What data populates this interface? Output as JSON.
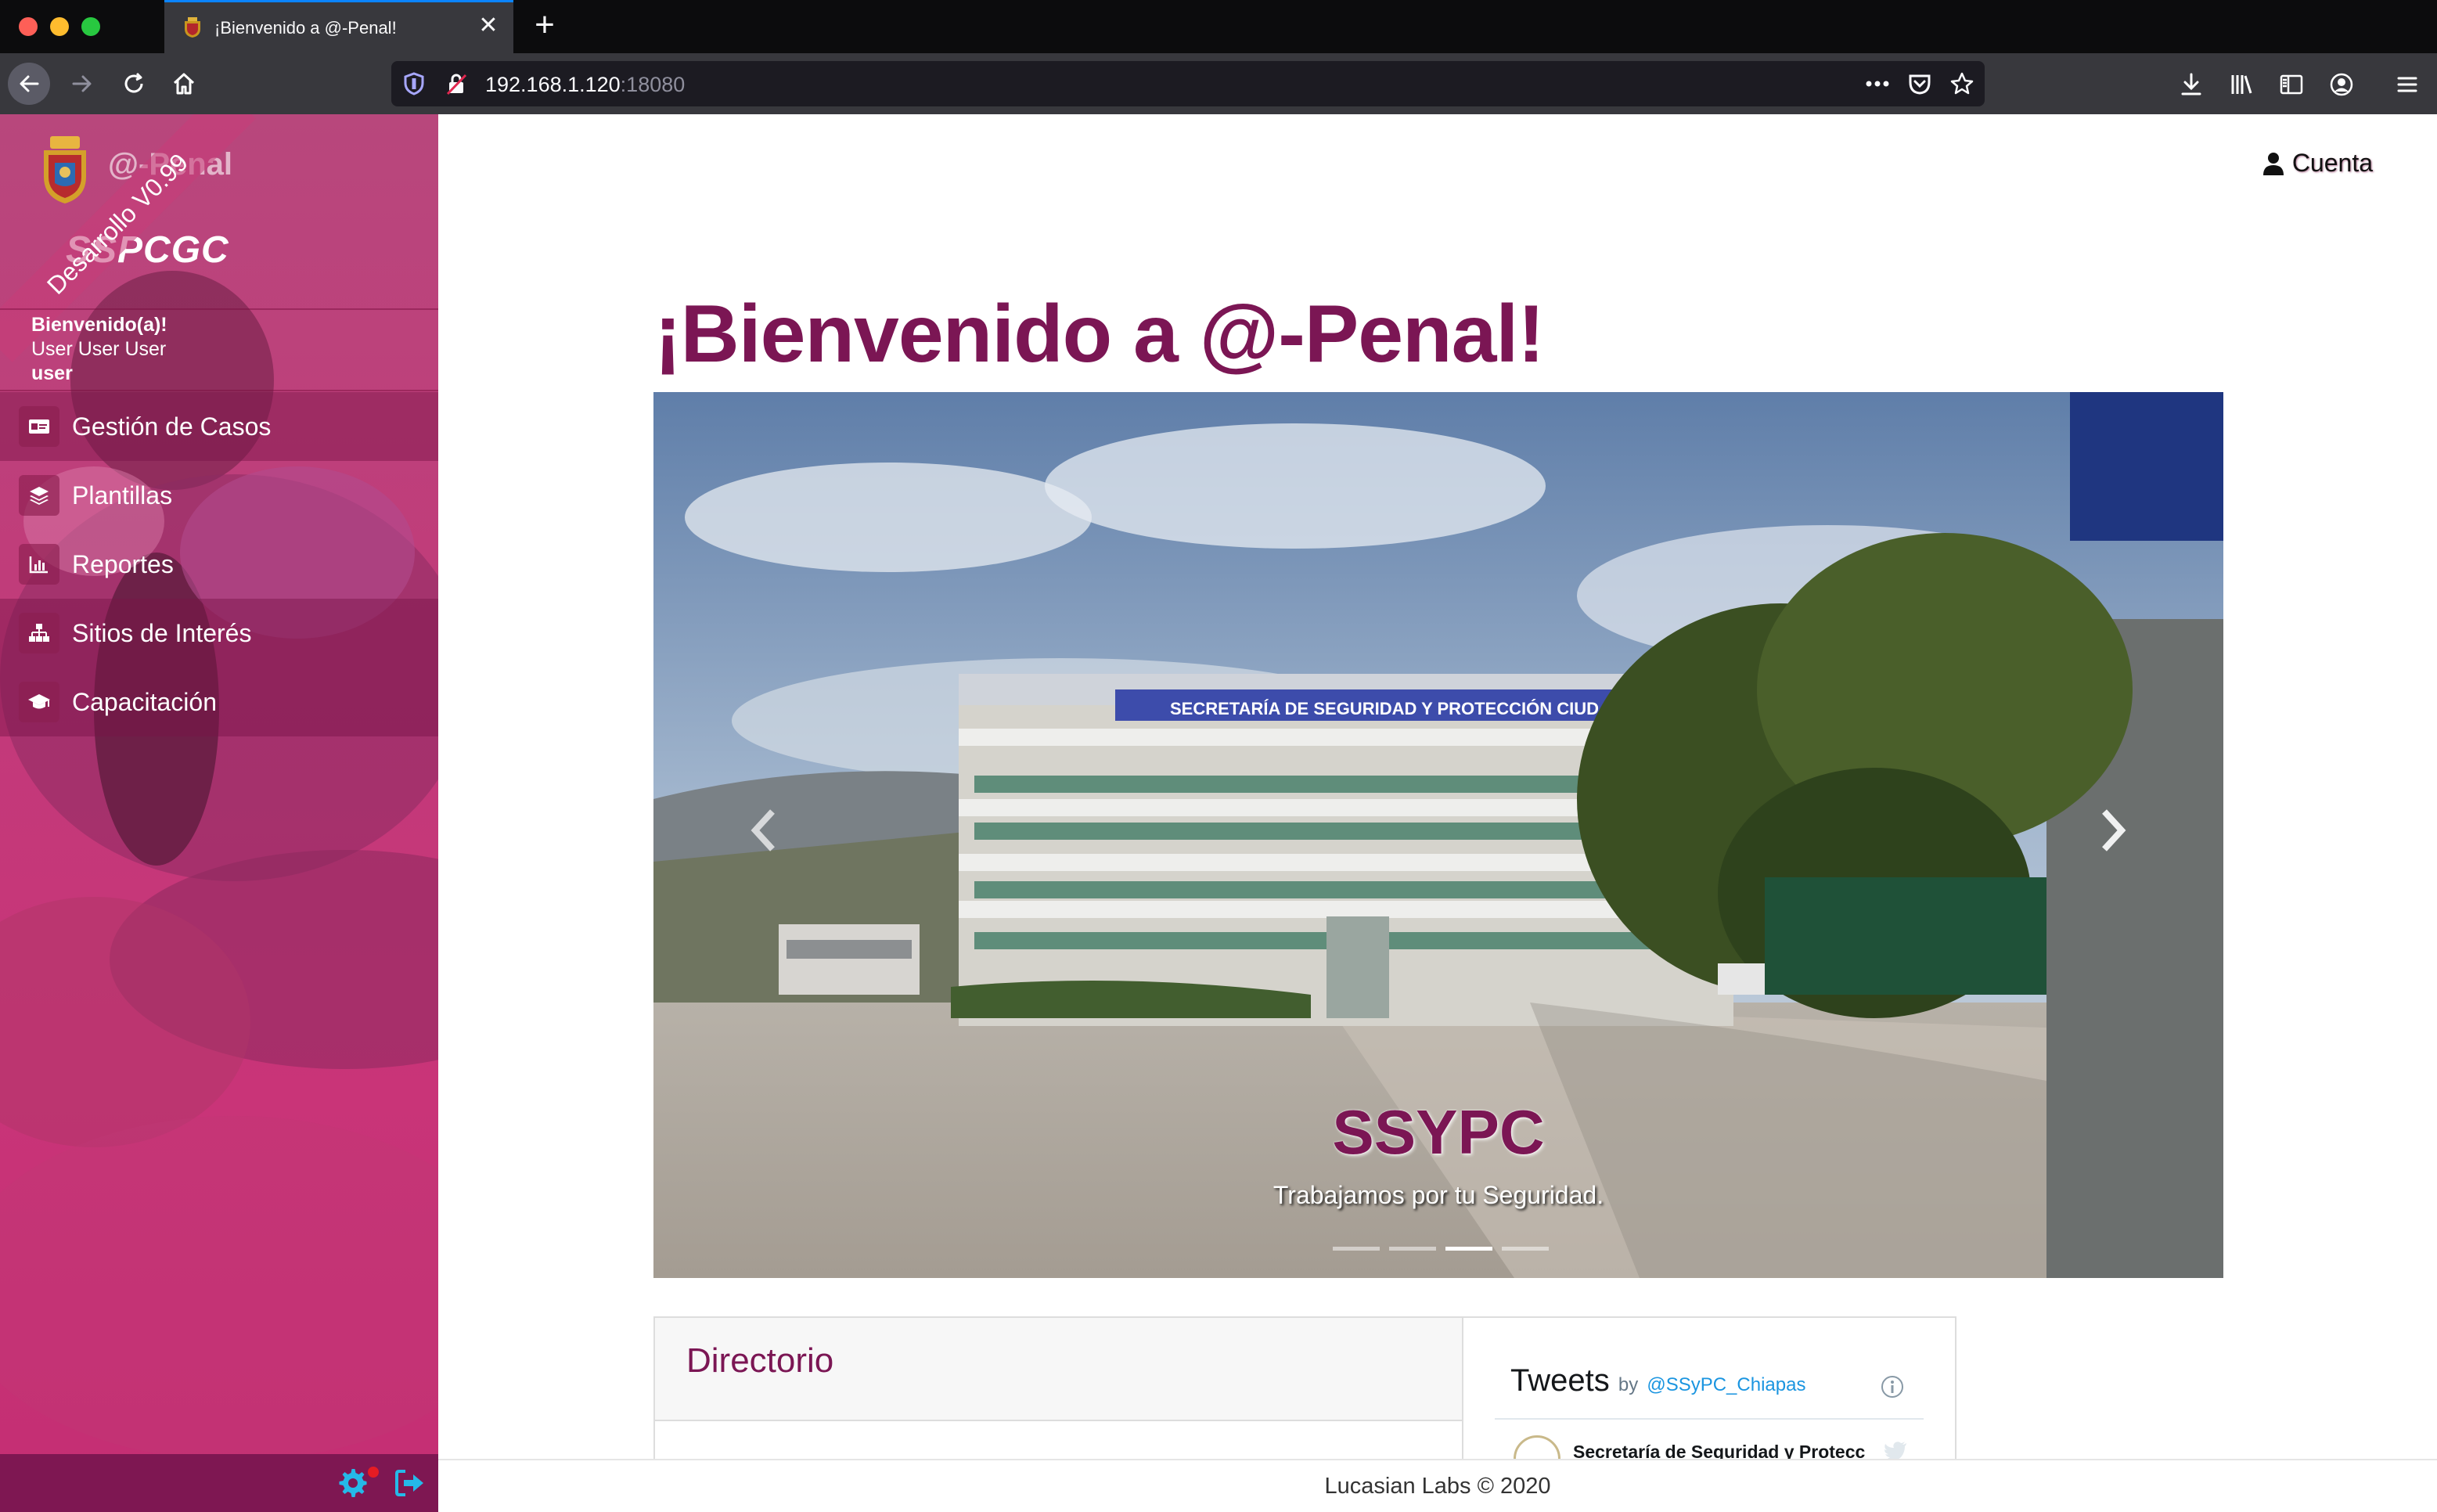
{
  "browser": {
    "tab_title": "¡Bienvenido a @-Penal!",
    "tab_close": "✕",
    "new_tab": "+",
    "url_host": "192.168.1.120",
    "url_port": ":18080"
  },
  "sidebar": {
    "brand_name": "@-Penal",
    "brand_sub": "SSPCGC",
    "version_ribbon": "Desarrollo V0.99",
    "welcome_line": "Bienvenido(a)!",
    "user_full_name": "User User User",
    "username": "user",
    "items": [
      {
        "label": "Gestión de Casos",
        "icon": "id-card-icon"
      },
      {
        "label": "Plantillas",
        "icon": "layers-icon"
      },
      {
        "label": "Reportes",
        "icon": "chart-icon"
      },
      {
        "label": "Sitios de Interés",
        "icon": "sitemap-icon"
      },
      {
        "label": "Capacitación",
        "icon": "graduation-cap-icon"
      }
    ]
  },
  "header": {
    "account_label": "Cuenta"
  },
  "main": {
    "title": "¡Bienvenido a @-Penal!",
    "carousel": {
      "caption_title": "SSYPC",
      "caption_text": "Trabajamos por tu Seguridad.",
      "building_sign": "SECRETARÍA DE SEGURIDAD Y PROTECCIÓN CIUDADANA",
      "slide_count": 4,
      "active_slide": 3
    },
    "directorio_title": "Directorio",
    "tweets": {
      "title": "Tweets",
      "by": "by",
      "handle": "@SSyPC_Chiapas",
      "first_author": "Secretaría de Seguridad y Protecc"
    }
  },
  "footer": {
    "text": "Lucasian Labs © 2020"
  },
  "colors": {
    "brand": "#7b1654",
    "sidebar_pink": "#c23a7a",
    "sidebar_footer": "#7e1752",
    "footer_icons": "#25b9e8"
  }
}
